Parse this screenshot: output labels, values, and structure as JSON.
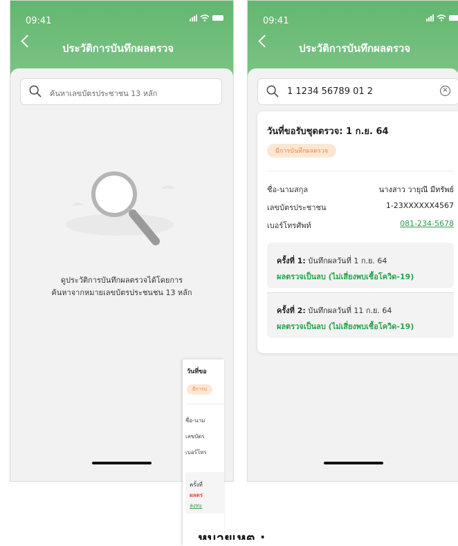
{
  "screen_a": {
    "time": "09:41",
    "title": "ประวัติการบันทึกผลตรวจ",
    "search_placeholder": "ค้นหาเลขบัตรประชาชน 13 หลัก",
    "empty_line1": "ดูประวัติการบันทึกผลตรวจได้โดยการ",
    "empty_line2": "ค้นหาจากหมายเลขบัตรประชนชน 13 หลัก",
    "icons": [
      "back-chevron",
      "signal",
      "wifi",
      "battery",
      "search",
      "magnifier-illustration"
    ]
  },
  "screen_b": {
    "time": "09:41",
    "title": "ประวัติการบันทึกผลตรวจ",
    "search_value": "1 1234 56789 01 2",
    "clear_symbol": "⊗",
    "card": {
      "title": "วันที่ขอรับชุดตรวจ: 1 ก.ย. 64",
      "badge": "มีการบันทึกผลตรวจ",
      "name_label": "ชื่อ-นามสกุล",
      "name_value": "นางสาว วายุณี มีทรัพย์",
      "id_label": "เลขบัตรประชาชน",
      "id_value": "1-23XXXXXX4567",
      "phone_label": "เบอร์โทรศัพท์",
      "phone_value": "081-234-5678",
      "records": [
        {
          "round": "ครั้งที่ 1:",
          "detail": "บันทึกผลวันที่ 1 ก.ย. 64",
          "result": "ผลตรวจเป็นลบ (ไม่เสี่ยงพบเชื้อโควิด-19)"
        },
        {
          "round": "ครั้งที่ 2:",
          "detail": "บันทึกผลวันที่ 11 ก.ย. 64",
          "result": "ผลตรวจเป็นลบ (ไม่เสี่ยงพบเชื้อโควิด-19)"
        }
      ]
    }
  },
  "partial_card": {
    "title": "วันที่ขอ",
    "badge": "มีการบ",
    "row1": "ชื่อ-นาม",
    "row2": "เลขบัตร",
    "row3": "เบอร์โทร",
    "rec_round": "ครั้งที่",
    "rec_result": "ผลตร",
    "rec_link": "ลงทะ"
  },
  "caption": "หมายเหตุ :",
  "colors": {
    "header_green": "#6cbb76",
    "result_green": "#27a34a",
    "badge_bg": "#fde7d4",
    "badge_text": "#f08a3b",
    "alert_red": "#e24b3b"
  }
}
